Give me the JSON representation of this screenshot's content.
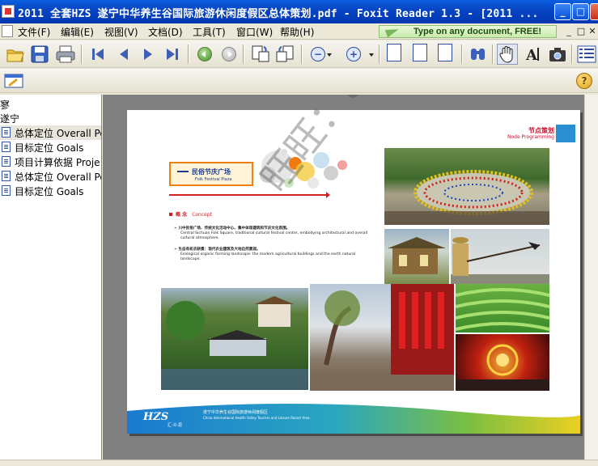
{
  "window": {
    "title": "2011 全套HZS 遂宁中华养生谷国际旅游休闲度假区总体策划.pdf - Foxit Reader 1.3 - [2011 ...",
    "minimize": "_",
    "maximize": "□",
    "close": "✕"
  },
  "menu": {
    "items": [
      "文件(F)",
      "编辑(E)",
      "视图(V)",
      "文档(D)",
      "工具(T)",
      "窗口(W)",
      "帮助(H)"
    ],
    "ad_text": "Type on any document, FREE!",
    "mdi_minimize": "_",
    "mdi_restore": "□",
    "mdi_close": "✕"
  },
  "toolbar": {
    "icons": [
      "open-icon",
      "save-icon",
      "print-icon",
      "first-page-icon",
      "prev-page-icon",
      "next-page-icon",
      "last-page-icon",
      "back-icon",
      "forward-icon",
      "rotate-left-icon",
      "rotate-right-icon",
      "zoom-out-icon",
      "zoom-in-icon",
      "single-page-icon",
      "continuous-icon",
      "facing-icon",
      "find-icon",
      "hand-tool-icon",
      "text-select-icon",
      "snapshot-icon",
      "bookmarks-panel-icon",
      "help-icon"
    ],
    "zoom_out_symbol": "−",
    "zoom_in_symbol": "+",
    "help_symbol": "?"
  },
  "bookmarks": {
    "root_partial": "寥",
    "parent": "遂宁",
    "items": [
      {
        "label": "总体定位 Overall Po",
        "selected": true
      },
      {
        "label": "目标定位 Goals",
        "selected": false
      },
      {
        "label": "项目计算依据 Proje",
        "selected": false
      },
      {
        "label": "总体定位 Overall Po",
        "selected": false
      },
      {
        "label": "目标定位 Goals",
        "selected": false
      }
    ]
  },
  "page": {
    "header_cn": "节点策划",
    "header_en": "Node Programming",
    "box_title_cn": "民俗节庆广场",
    "box_title_en": "Folk Festival Plaza",
    "concept_label": "概 念",
    "concept_en": "Concept",
    "bullet1_cn": "➢ 川中民俗广场、传统文化活动中心、集中体现建筑和节庆文化氛围。",
    "bullet1_en": "Central Sichuan Folk Square, traditional cultural festival center, embodying architectural and overall cultural atmosphere.",
    "bullet2_cn": "➢ 生态有机农耕景：现代农业建筑及大地自然景观。",
    "bullet2_en": "Ecological organic farming landscape: the modern agricultural buildings and the earth natural landscape.",
    "footer_logo": "HZS",
    "footer_sub": "汇·众·思",
    "footer_cn": "遂宁中华养生谷国际旅游休闲度假区",
    "footer_en": "China International Health Valley Tourism and Leisure Resort Area",
    "watermark": "旺旺：taijin188"
  },
  "colors": {
    "accent_red": "#c8102e",
    "accent_blue": "#2a8fd0",
    "box_orange": "#f08010",
    "titlebar_blue": "#0846c4"
  }
}
